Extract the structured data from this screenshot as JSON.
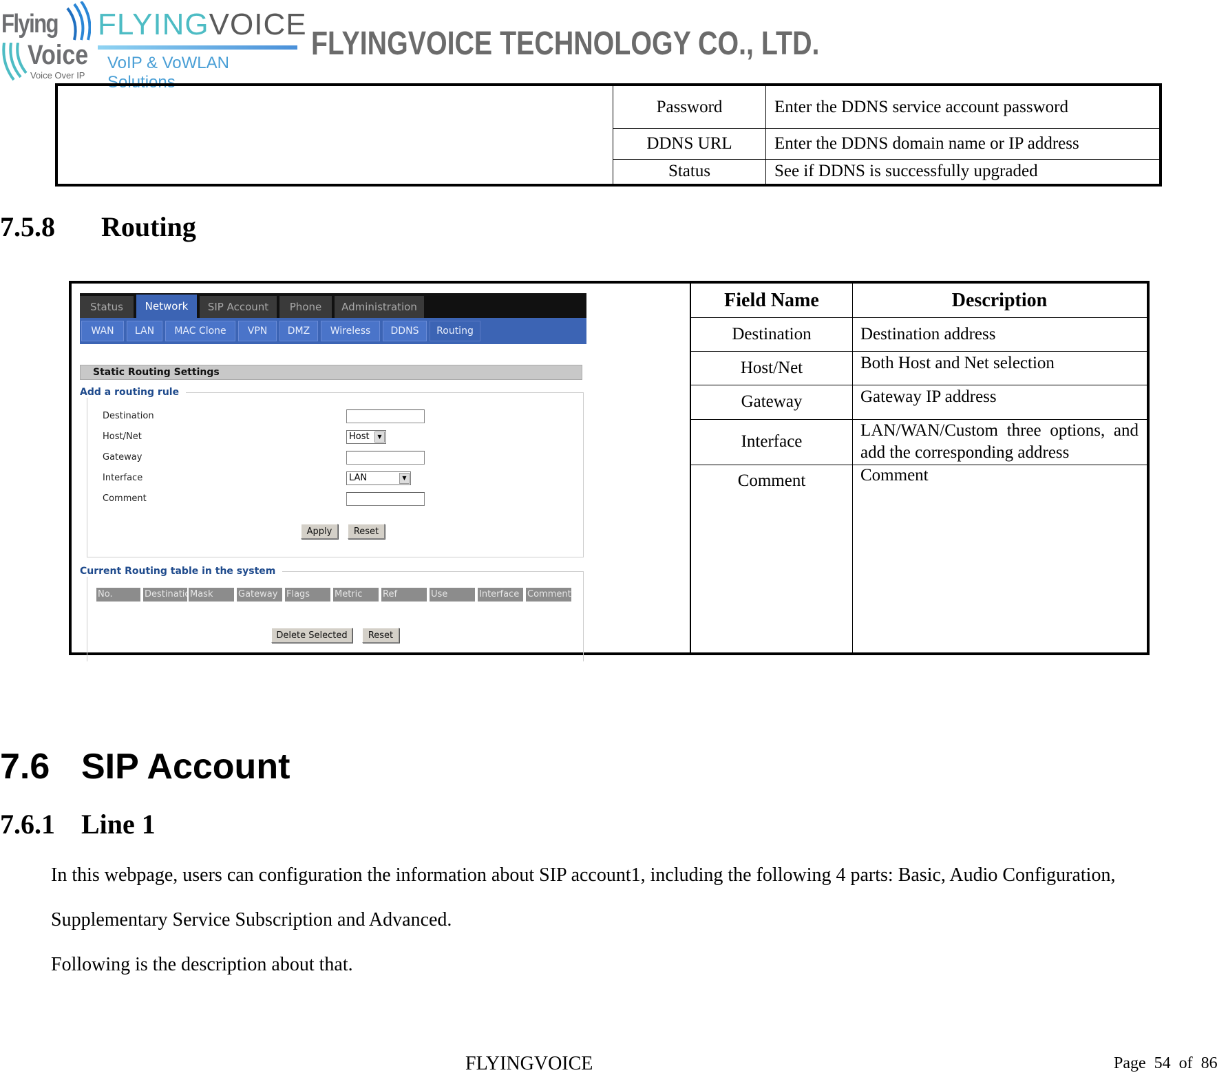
{
  "header": {
    "logo_left": {
      "line1": "Flying",
      "line2": "Voice",
      "tagline": "Voice Over IP"
    },
    "logo_mid": {
      "brand_a": "FLYING",
      "brand_b": "VOICE",
      "tagline": "VoIP & VoWLAN Solutions"
    },
    "company": "FLYINGVOICE TECHNOLOGY CO., LTD."
  },
  "ddns_table": {
    "rows": [
      {
        "field": "Password",
        "description": "Enter the DDNS service account password"
      },
      {
        "field": "DDNS URL",
        "description": "Enter the DDNS domain name or IP address"
      },
      {
        "field": "Status",
        "description": "See if DDNS is successfully upgraded"
      }
    ]
  },
  "section_routing": {
    "number": "7.5.8",
    "title": "Routing"
  },
  "screenshot": {
    "top_tabs": [
      "Status",
      "Network",
      "SIP Account",
      "Phone",
      "Administration"
    ],
    "active_top_tab": "Network",
    "sub_tabs": [
      "WAN",
      "LAN",
      "MAC Clone",
      "VPN",
      "DMZ",
      "Wireless",
      "DDNS",
      "Routing"
    ],
    "active_sub_tab": "Routing",
    "section_title": "Static Routing Settings",
    "add_rule_legend": "Add a routing rule",
    "fields": {
      "destination": {
        "label": "Destination",
        "value": ""
      },
      "host_net": {
        "label": "Host/Net",
        "value": "Host"
      },
      "gateway": {
        "label": "Gateway",
        "value": ""
      },
      "interface": {
        "label": "Interface",
        "value": "LAN"
      },
      "comment": {
        "label": "Comment",
        "value": ""
      }
    },
    "apply_label": "Apply",
    "reset_label": "Reset",
    "current_table_legend": "Current Routing table in the system",
    "table_headers": [
      "No.",
      "Destination",
      "Mask",
      "Gateway",
      "Flags",
      "Metric",
      "Ref",
      "Use",
      "Interface",
      "Comment"
    ],
    "delete_selected_label": "Delete Selected",
    "reset2_label": "Reset"
  },
  "field_table": {
    "headers": {
      "field": "Field Name",
      "description": "Description"
    },
    "rows": [
      {
        "field": "Destination",
        "description": "Destination address"
      },
      {
        "field": "Host/Net",
        "description": "Both Host and Net selection"
      },
      {
        "field": "Gateway",
        "description": "Gateway IP address"
      },
      {
        "field": "Interface",
        "description": "LAN/WAN/Custom three options, and add the corresponding address"
      },
      {
        "field": "Comment",
        "description": "Comment"
      }
    ]
  },
  "section_sip": {
    "number": "7.6",
    "title": "SIP Account"
  },
  "section_line1": {
    "number": "7.6.1",
    "title": "Line 1"
  },
  "paragraphs": [
    "In this webpage, users can configuration the information about SIP account1, including the following 4 parts: Basic, Audio Configuration,",
    "Supplementary Service Subscription and Advanced.",
    "Following is the description about that."
  ],
  "footer": {
    "center": "FLYINGVOICE",
    "page_word": "Page",
    "page": "54",
    "of_word": "of",
    "total": "86"
  }
}
